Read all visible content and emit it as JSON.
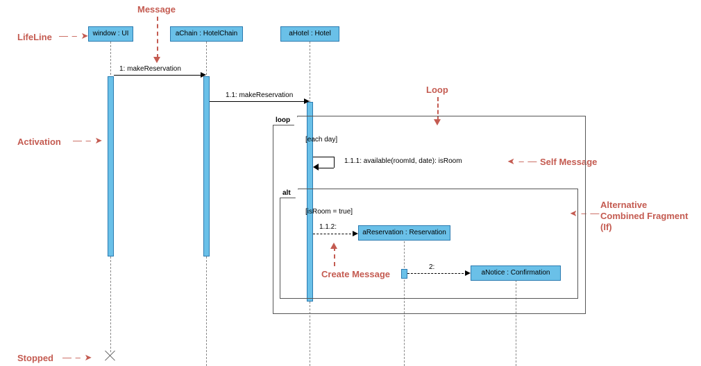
{
  "annotations": {
    "message": "Message",
    "lifeline": "LifeLine",
    "activation": "Activation",
    "loop_label": "Loop",
    "self_message": "Self Message",
    "alt_label_l1": "Alternative",
    "alt_label_l2": "Combined Fragment",
    "alt_label_l3": "(If)",
    "create_message": "Create Message",
    "stopped": "Stopped"
  },
  "lifelines": {
    "ui": "window : UI",
    "chain": "aChain : HotelChain",
    "hotel": "aHotel : Hotel",
    "reservation": "aReservation : Reservation",
    "confirmation": "aNotice : Confirmation"
  },
  "messages": {
    "m1": "1: makeReservation",
    "m11": "1.1: makeReservation",
    "m111": "1.1.1:  available(roomId, date): isRoom",
    "m112": "1.1.2:",
    "m2": "2:"
  },
  "fragments": {
    "loop_tag": "loop",
    "loop_guard": "[each day]",
    "alt_tag": "alt",
    "alt_guard": "[isRoom = true]"
  },
  "chart_data": {
    "type": "uml-sequence",
    "lifelines": [
      {
        "id": "ui",
        "label": "window : UI"
      },
      {
        "id": "chain",
        "label": "aChain : HotelChain"
      },
      {
        "id": "hotel",
        "label": "aHotel : Hotel"
      },
      {
        "id": "reservation",
        "label": "aReservation : Reservation",
        "created_by": "m112"
      },
      {
        "id": "confirmation",
        "label": "aNotice : Confirmation",
        "created_by": "m2"
      }
    ],
    "messages": [
      {
        "id": "m1",
        "from": "ui",
        "to": "chain",
        "label": "1: makeReservation",
        "type": "sync"
      },
      {
        "id": "m11",
        "from": "chain",
        "to": "hotel",
        "label": "1.1: makeReservation",
        "type": "sync"
      },
      {
        "id": "m111",
        "from": "hotel",
        "to": "hotel",
        "label": "1.1.1:  available(roomId, date): isRoom",
        "type": "self"
      },
      {
        "id": "m112",
        "from": "hotel",
        "to": "reservation",
        "label": "1.1.2:",
        "type": "create"
      },
      {
        "id": "m2",
        "from": "reservation",
        "to": "confirmation",
        "label": "2:",
        "type": "create"
      }
    ],
    "fragments": [
      {
        "type": "loop",
        "guard": "[each day]",
        "contains": [
          "m111",
          "alt1"
        ]
      },
      {
        "id": "alt1",
        "type": "alt",
        "operands": [
          {
            "guard": "[isRoom = true]",
            "contains": [
              "m112",
              "m2"
            ]
          }
        ]
      }
    ],
    "stopped": [
      "ui"
    ]
  }
}
